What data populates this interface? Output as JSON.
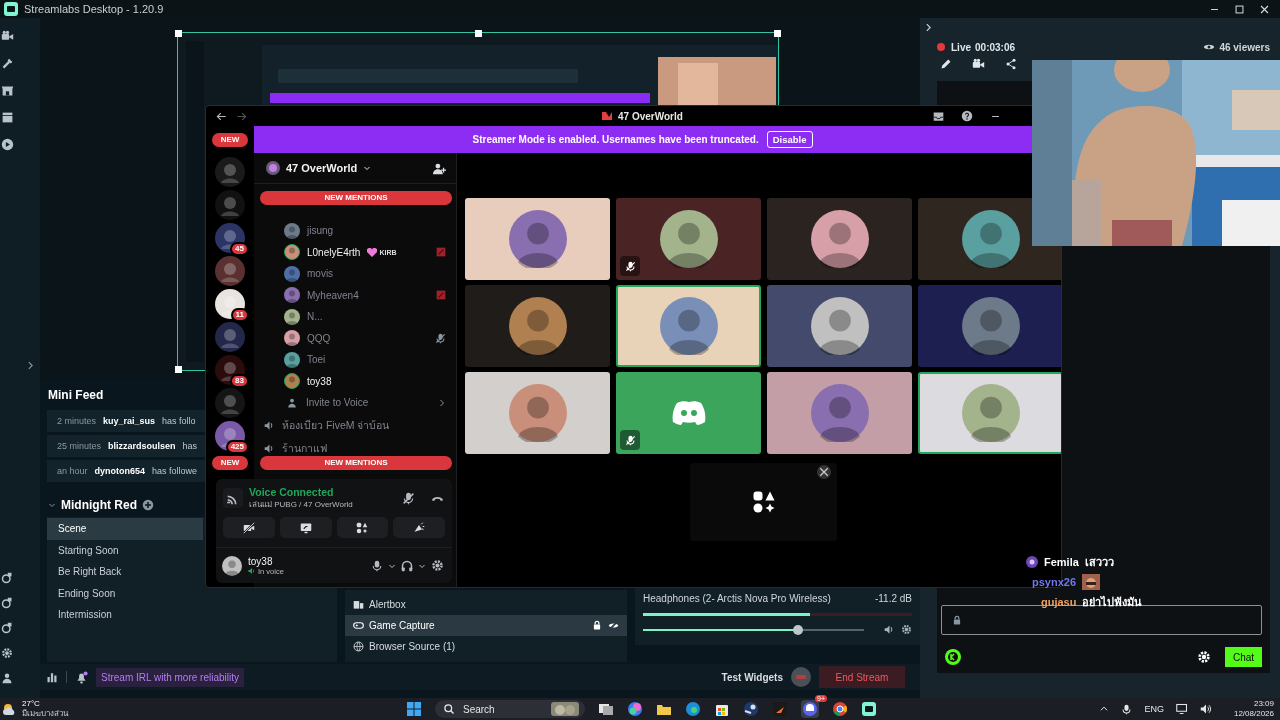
{
  "app": {
    "title": "Streamlabs Desktop - 1.20.9"
  },
  "mini_feed": {
    "title": "Mini Feed",
    "events": [
      {
        "time": "2 minutes",
        "user": "kuy_rai_sus",
        "text": "has follo"
      },
      {
        "time": "25 minutes",
        "user": "blizzardsoulsen",
        "text": "has"
      },
      {
        "time": "an hour",
        "user": "dynoton654",
        "text": "has followe"
      }
    ]
  },
  "scenes": {
    "collection": "Midnight Red",
    "items": [
      {
        "label": "Scene",
        "selected": true
      },
      {
        "label": "Starting Soon",
        "selected": false
      },
      {
        "label": "Be Right Back",
        "selected": false
      },
      {
        "label": "Ending Soon",
        "selected": false
      },
      {
        "label": "Intermission",
        "selected": false
      }
    ]
  },
  "sources": [
    {
      "label": "Alertbox",
      "kind": "widget",
      "selected": false
    },
    {
      "label": "Game Capture",
      "kind": "game",
      "selected": true
    },
    {
      "label": "Browser Source (1)",
      "kind": "browser",
      "selected": false
    }
  ],
  "mixer": {
    "name": "Headphones (2- Arctis Nova Pro Wireless)",
    "reading": "-11.2 dB",
    "meter": {
      "level": 0.62
    },
    "volume": {
      "level": 0.7
    }
  },
  "footer": {
    "promo": "Stream IRL with more reliability",
    "test_widgets": "Test Widgets",
    "end_stream": "End Stream"
  },
  "live": {
    "status": "Live",
    "time": "00:03:06",
    "viewers": "46 viewers"
  },
  "chat": {
    "messages": [
      {
        "user": "Femila",
        "color": "#ffffff",
        "kind": "text",
        "text": "เสววว"
      },
      {
        "user": "psynx26",
        "color": "#6f78f0",
        "kind": "emote"
      },
      {
        "user": "gujasu",
        "color": "#f0a35e",
        "kind": "text",
        "text": "อย่าไปฟังมัน"
      }
    ],
    "send": "Chat"
  },
  "discord": {
    "title": "47 OverWorld",
    "banner": {
      "text": "Streamer Mode is enabled. Usernames have been truncated.",
      "button": "Disable"
    },
    "servers": [
      {
        "kind": "pill",
        "label": "NEW"
      },
      {
        "kind": "icon"
      },
      {
        "kind": "icon"
      },
      {
        "kind": "icon",
        "badge": "45"
      },
      {
        "kind": "icon"
      },
      {
        "kind": "icon",
        "badge": "11"
      },
      {
        "kind": "icon"
      },
      {
        "kind": "icon",
        "badge": "83"
      },
      {
        "kind": "icon"
      },
      {
        "kind": "icon",
        "badge": "425"
      }
    ],
    "bottom_pill": "NEW",
    "server_name": "47 OverWorld",
    "members": [
      {
        "name": "jisung",
        "speaking": false,
        "muted": false,
        "activity": false
      },
      {
        "name": "L0nelyE4rth",
        "tag": "KIRB",
        "speaking": true,
        "muted": false,
        "activity": true
      },
      {
        "name": "movis",
        "speaking": false,
        "muted": false,
        "activity": false
      },
      {
        "name": "Myheaven4",
        "speaking": false,
        "muted": false,
        "activity": true
      },
      {
        "name": "N...",
        "speaking": false,
        "muted": false,
        "activity": false
      },
      {
        "name": "QQQ",
        "speaking": false,
        "muted": true,
        "activity": false
      },
      {
        "name": "Toei",
        "speaking": false,
        "muted": false,
        "activity": false
      },
      {
        "name": "toy38",
        "speaking": true,
        "muted": false,
        "activity": false
      }
    ],
    "invite": "Invite to Voice",
    "voice_channels": [
      "ห้องเบียว FiveM จ่าบ้อน",
      "ร้านกาแฟ"
    ],
    "mention_pills": [
      "NEW MENTIONS",
      "NEW MENTIONS"
    ],
    "voice": {
      "status": "Voice Connected",
      "channel": "เล่นแม่ PUBG / 47 OverWorld"
    },
    "user": {
      "name": "toy38",
      "status": "In voice"
    },
    "tiles": [
      {
        "kind": "avatar",
        "color": "#e8cdbd",
        "speaking": false,
        "muted": false
      },
      {
        "kind": "avatar",
        "color": "#4a2424",
        "speaking": false,
        "muted": true
      },
      {
        "kind": "avatar",
        "color": "#2b2320",
        "speaking": false,
        "muted": false
      },
      {
        "kind": "avatar",
        "color": "#2f271f",
        "speaking": false,
        "muted": false
      },
      {
        "kind": "avatar",
        "color": "#201c19",
        "speaking": false,
        "muted": false
      },
      {
        "kind": "avatar",
        "color": "#e9d3b8",
        "speaking": true,
        "muted": false
      },
      {
        "kind": "avatar",
        "color": "#434a6b",
        "speaking": false,
        "muted": false
      },
      {
        "kind": "avatar",
        "color": "#1c1f4f",
        "speaking": false,
        "muted": false
      },
      {
        "kind": "avatar",
        "color": "#d2cfcd",
        "speaking": false,
        "muted": false
      },
      {
        "kind": "default",
        "color": "#3ba55c",
        "speaking": false,
        "muted": true
      },
      {
        "kind": "avatar",
        "color": "#c49ea6",
        "speaking": false,
        "muted": false
      },
      {
        "kind": "avatar",
        "color": "#dcdbe0",
        "speaking": true,
        "muted": false
      }
    ]
  },
  "taskbar": {
    "temperature": "27°C",
    "weather": "มีเมฆบางส่วน",
    "search": "Search",
    "badge": "9+",
    "language": "ENG",
    "time": "23:09",
    "date": "12/08/2026"
  }
}
